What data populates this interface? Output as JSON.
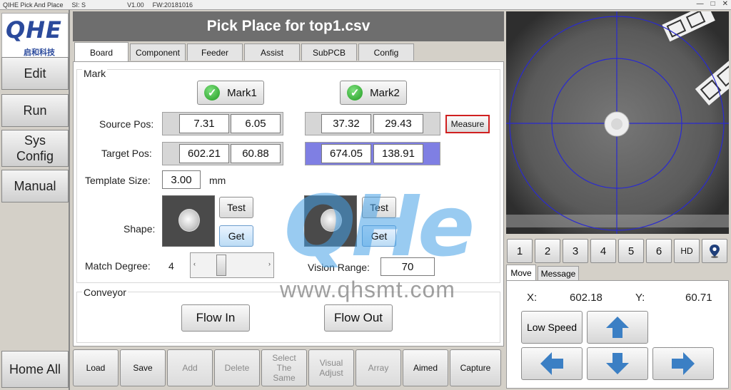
{
  "titlebar": {
    "app_name": "QIHE Pick And Place",
    "si_label": "SI: S",
    "version": "V1.00",
    "firmware": "FW:20181016",
    "minimize": "—",
    "maximize": "□",
    "close": "✕"
  },
  "sidebar": {
    "logo_main": "QHE",
    "logo_sub": "启和科技",
    "edit": "Edit",
    "run": "Run",
    "sys_config": "Sys Config",
    "manual": "Manual",
    "home_all": "Home All"
  },
  "header": {
    "title": "Pick Place for top1.csv"
  },
  "tabs": [
    "Board",
    "Component",
    "Feeder",
    "Assist",
    "SubPCB",
    "Config"
  ],
  "mark": {
    "group_label": "Mark",
    "mark1_label": "Mark1",
    "mark2_label": "Mark2",
    "source_pos_label": "Source Pos:",
    "target_pos_label": "Target Pos:",
    "source1_x": "7.31",
    "source1_y": "6.05",
    "source2_x": "37.32",
    "source2_y": "29.43",
    "target1_x": "602.21",
    "target1_y": "60.88",
    "target2_x": "674.05",
    "target2_y": "138.91",
    "measure_label": "Measure",
    "template_size_label": "Template Size:",
    "template_size_value": "3.00",
    "template_size_unit": "mm",
    "shape_label": "Shape:",
    "test_label": "Test",
    "get_label": "Get",
    "match_degree_label": "Match Degree:",
    "match_degree_value": "4",
    "slider_left_arrow": "‹",
    "slider_right_arrow": "›",
    "vision_range_label": "Vision Range:",
    "vision_range_value": "70"
  },
  "conveyor": {
    "group_label": "Conveyor",
    "flow_in_label": "Flow In",
    "flow_out_label": "Flow Out"
  },
  "watermark": {
    "logo": "QHe",
    "url": "www.qhsmt.com"
  },
  "toolbar": {
    "load": "Load",
    "save": "Save",
    "add": "Add",
    "delete": "Delete",
    "select_same": "Select The Same",
    "visual_adjust": "Visual Adjust",
    "array": "Array",
    "aimed": "Aimed",
    "capture": "Capture"
  },
  "camera_buttons": [
    "1",
    "2",
    "3",
    "4",
    "5",
    "6",
    "HD"
  ],
  "move_tabs": [
    "Move",
    "Message"
  ],
  "move": {
    "x_label": "X:",
    "x_value": "602.18",
    "y_label": "Y:",
    "y_value": "60.71",
    "speed_label": "Low Speed"
  },
  "icons": {
    "check": "check-icon",
    "up": "arrow-up-icon",
    "down": "arrow-down-icon",
    "left": "arrow-left-icon",
    "right": "arrow-right-icon",
    "pin": "map-pin-icon"
  },
  "colors": {
    "header_bg": "#6e6e6e",
    "accent_blue": "#3b7fc4",
    "target2_bg": "#7f7fe3",
    "measure_border": "#d02020",
    "crosshair": "#2a2ad0"
  }
}
